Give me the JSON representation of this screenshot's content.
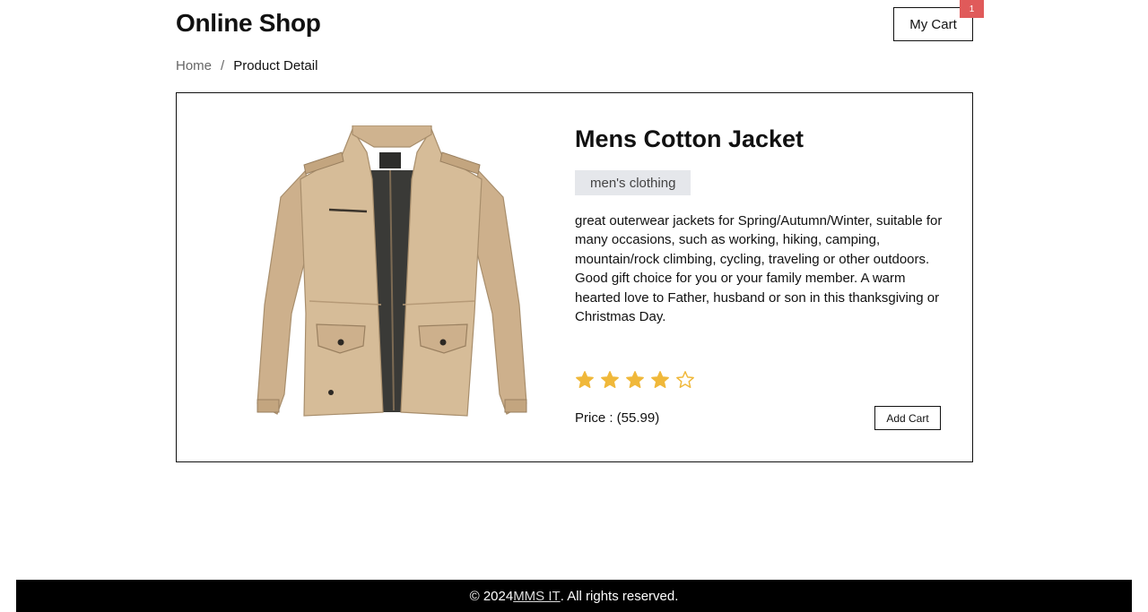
{
  "header": {
    "title": "Online Shop",
    "cart_label": "My Cart",
    "cart_count": "1"
  },
  "breadcrumb": {
    "home": "Home",
    "separator": "/",
    "current": "Product Detail"
  },
  "product": {
    "title": "Mens Cotton Jacket",
    "category": "men's clothing",
    "description": "great outerwear jackets for Spring/Autumn/Winter, suitable for many occasions, such as working, hiking, camping, mountain/rock climbing, cycling, traveling or other outdoors. Good gift choice for you or your family member. A warm hearted love to Father, husband or son in this thanksgiving or Christmas Day.",
    "rating": {
      "filled": 4,
      "max": 5
    },
    "price_text": "Price : (55.99)",
    "add_cart_label": "Add Cart",
    "image_icon": "jacket-image"
  },
  "footer": {
    "prefix": "© 2024 ",
    "link_text": "MMS IT",
    "suffix": ". All rights reserved."
  },
  "colors": {
    "badge": "#e05a5a",
    "star": "#f0b83a",
    "category_bg": "#e5e7eb",
    "footer_bg": "#000000"
  }
}
